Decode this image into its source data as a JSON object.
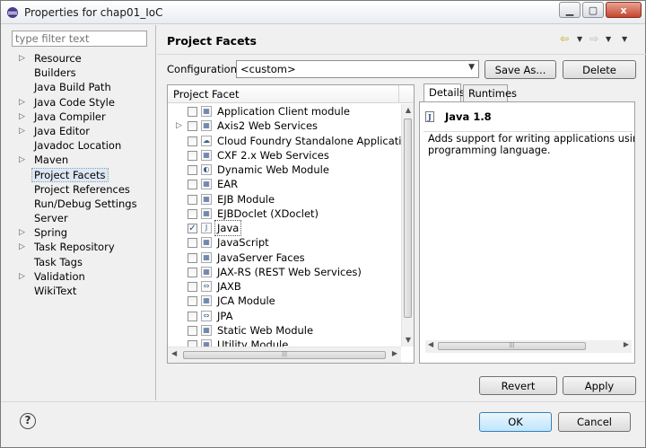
{
  "window": {
    "title": "Properties for chap01_IoC",
    "controls": [
      "▁",
      "▢",
      "x"
    ]
  },
  "nav": {
    "filter_placeholder": "type filter text",
    "items": [
      {
        "label": "Resource",
        "expandable": true
      },
      {
        "label": "Builders",
        "expandable": false
      },
      {
        "label": "Java Build Path",
        "expandable": false
      },
      {
        "label": "Java Code Style",
        "expandable": true
      },
      {
        "label": "Java Compiler",
        "expandable": true
      },
      {
        "label": "Java Editor",
        "expandable": true
      },
      {
        "label": "Javadoc Location",
        "expandable": false
      },
      {
        "label": "Maven",
        "expandable": true
      },
      {
        "label": "Project Facets",
        "expandable": false,
        "selected": true
      },
      {
        "label": "Project References",
        "expandable": false
      },
      {
        "label": "Run/Debug Settings",
        "expandable": false
      },
      {
        "label": "Server",
        "expandable": false
      },
      {
        "label": "Spring",
        "expandable": true
      },
      {
        "label": "Task Repository",
        "expandable": true
      },
      {
        "label": "Task Tags",
        "expandable": false
      },
      {
        "label": "Validation",
        "expandable": true
      },
      {
        "label": "WikiText",
        "expandable": false
      }
    ]
  },
  "page": {
    "title": "Project Facets",
    "configuration_label": "Configuration:",
    "configuration_value": "<custom>",
    "save_as_label": "Save As...",
    "delete_label": "Delete"
  },
  "facets": {
    "column_header": "Project Facet",
    "rows": [
      {
        "label": "Application Client module",
        "checked": false,
        "expandable": false
      },
      {
        "label": "Axis2 Web Services",
        "checked": false,
        "expandable": true
      },
      {
        "label": "Cloud Foundry Standalone Application",
        "checked": false,
        "expandable": false
      },
      {
        "label": "CXF 2.x Web Services",
        "checked": false,
        "expandable": false
      },
      {
        "label": "Dynamic Web Module",
        "checked": false,
        "expandable": false
      },
      {
        "label": "EAR",
        "checked": false,
        "expandable": false
      },
      {
        "label": "EJB Module",
        "checked": false,
        "expandable": false
      },
      {
        "label": "EJBDoclet (XDoclet)",
        "checked": false,
        "expandable": false
      },
      {
        "label": "Java",
        "checked": true,
        "expandable": false,
        "selected": true
      },
      {
        "label": "JavaScript",
        "checked": false,
        "expandable": false
      },
      {
        "label": "JavaServer Faces",
        "checked": false,
        "expandable": false
      },
      {
        "label": "JAX-RS (REST Web Services)",
        "checked": false,
        "expandable": false
      },
      {
        "label": "JAXB",
        "checked": false,
        "expandable": false
      },
      {
        "label": "JCA Module",
        "checked": false,
        "expandable": false
      },
      {
        "label": "JPA",
        "checked": false,
        "expandable": false
      },
      {
        "label": "Static Web Module",
        "checked": false,
        "expandable": false
      },
      {
        "label": "Utility Module",
        "checked": false,
        "expandable": false
      }
    ]
  },
  "details": {
    "tab_details": "Details",
    "tab_runtimes": "Runtimes",
    "facet_title": "Java 1.8",
    "description_line1": "Adds support for writing applications using Jav",
    "description_line2": "programming language."
  },
  "footer": {
    "revert_label": "Revert",
    "apply_label": "Apply",
    "ok_label": "OK",
    "cancel_label": "Cancel",
    "help_glyph": "?"
  },
  "colors": {
    "selection": "#dde8f4",
    "default_button": "#bee6fd",
    "nav_arrow": "#c6a127"
  }
}
